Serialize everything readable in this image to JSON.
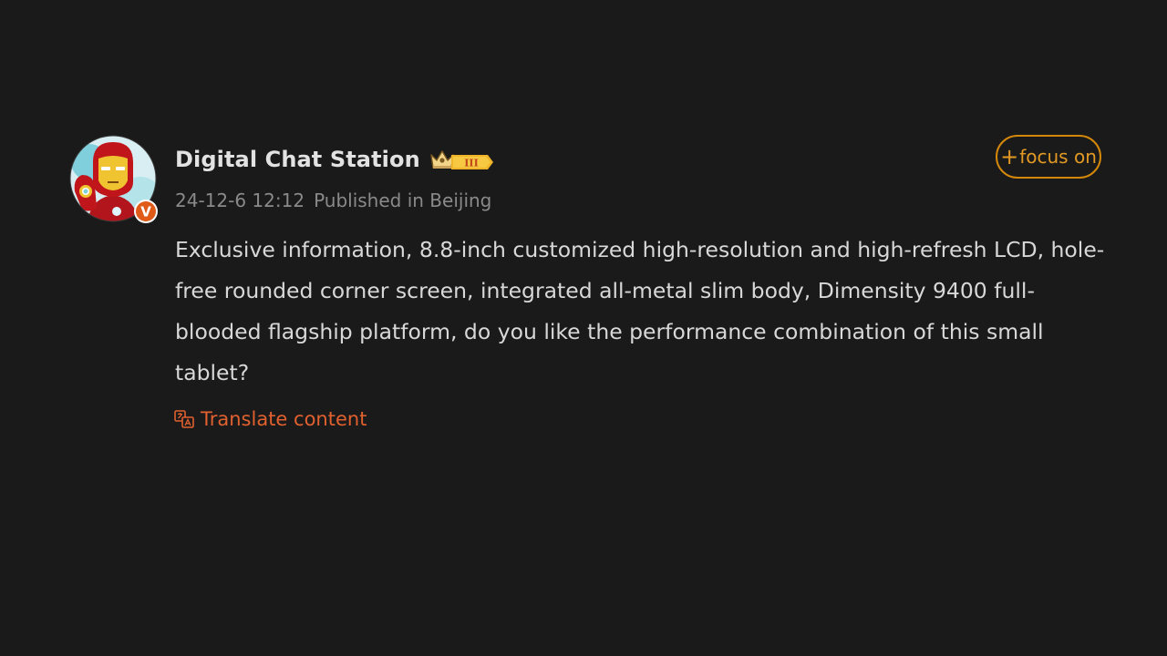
{
  "author": {
    "name": "Digital Chat Station",
    "verified_mark": "V",
    "level_badge": "III",
    "avatar_icon": "iron-man-avatar-icon",
    "crown_icon": "crown-icon"
  },
  "meta": {
    "date": "24-12-6 12:12",
    "location": "Published in Beijing"
  },
  "follow_button": {
    "plus": "+",
    "label": "focus on"
  },
  "post": {
    "text": "Exclusive information, 8.8-inch customized high-resolution and high-refresh LCD, hole-free rounded corner screen, integrated all-metal slim body, Dimensity 9400 full-blooded flagship platform, do you like the performance combination of this small tablet?"
  },
  "translate": {
    "label": "Translate content",
    "icon": "translate-icon"
  },
  "colors": {
    "background": "#1a1a1a",
    "accent_orange": "#e39a24",
    "translate_red": "#e0612f",
    "verified_bg": "#e05a18"
  }
}
